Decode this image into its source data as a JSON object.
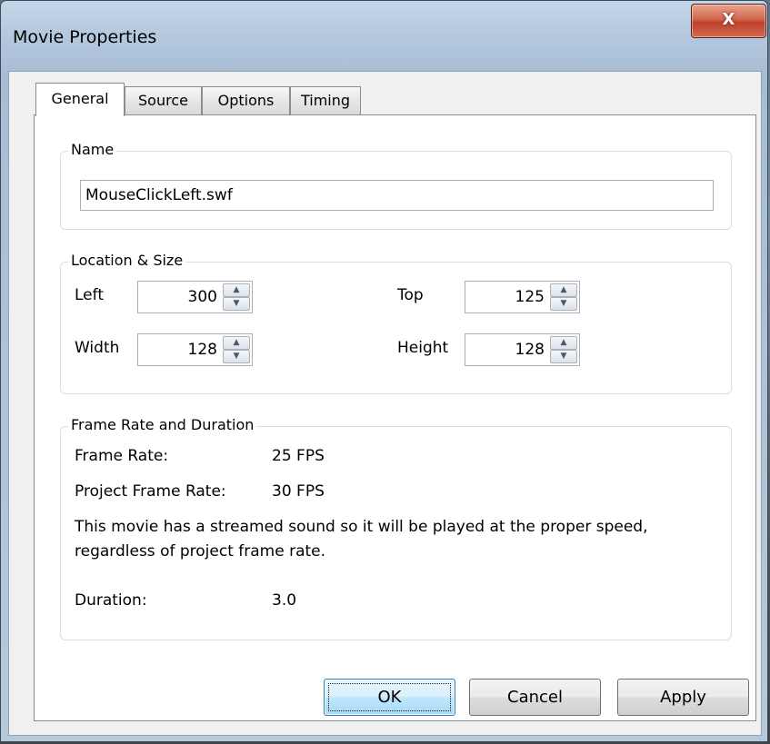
{
  "window": {
    "title": "Movie Properties",
    "close_glyph": "X"
  },
  "tabs": [
    {
      "label": "General",
      "active": true
    },
    {
      "label": "Source",
      "active": false
    },
    {
      "label": "Options",
      "active": false
    },
    {
      "label": "Timing",
      "active": false
    }
  ],
  "name_group": {
    "label": "Name",
    "value": "MouseClickLeft.swf"
  },
  "location_group": {
    "label": "Location & Size",
    "left_label": "Left",
    "left_value": "300",
    "top_label": "Top",
    "top_value": "125",
    "width_label": "Width",
    "width_value": "128",
    "height_label": "Height",
    "height_value": "128"
  },
  "frame_group": {
    "label": "Frame Rate and Duration",
    "frame_rate_label": "Frame Rate:",
    "frame_rate_value": "25 FPS",
    "project_rate_label": "Project Frame Rate:",
    "project_rate_value": "30 FPS",
    "note": "This movie has a streamed sound so it will be played at the proper speed, regardless of project frame rate.",
    "duration_label": "Duration:",
    "duration_value": "3.0"
  },
  "buttons": {
    "ok": "OK",
    "cancel": "Cancel",
    "apply": "Apply"
  },
  "icons": {
    "spin_up": "spin-up-arrow-icon",
    "spin_down": "spin-down-arrow-icon",
    "close": "close-icon"
  },
  "colors": {
    "close_button": "#c1402a",
    "default_button": "#bee6fd"
  }
}
